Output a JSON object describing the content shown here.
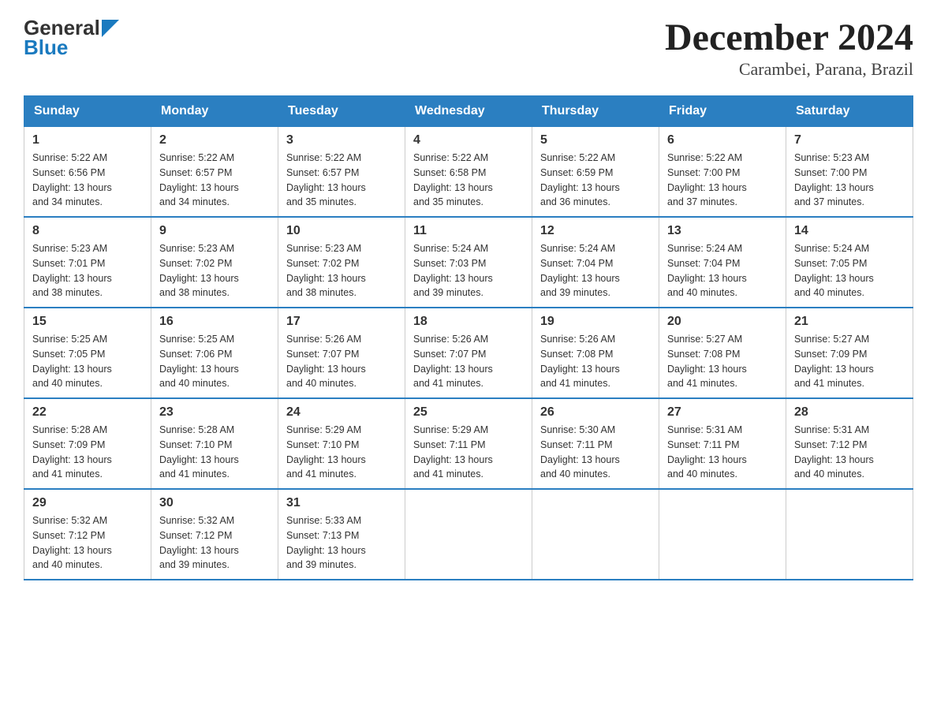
{
  "logo": {
    "general": "General",
    "blue": "Blue"
  },
  "title": "December 2024",
  "subtitle": "Carambei, Parana, Brazil",
  "weekdays": [
    "Sunday",
    "Monday",
    "Tuesday",
    "Wednesday",
    "Thursday",
    "Friday",
    "Saturday"
  ],
  "weeks": [
    [
      {
        "day": "1",
        "sunrise": "5:22 AM",
        "sunset": "6:56 PM",
        "daylight": "13 hours and 34 minutes."
      },
      {
        "day": "2",
        "sunrise": "5:22 AM",
        "sunset": "6:57 PM",
        "daylight": "13 hours and 34 minutes."
      },
      {
        "day": "3",
        "sunrise": "5:22 AM",
        "sunset": "6:57 PM",
        "daylight": "13 hours and 35 minutes."
      },
      {
        "day": "4",
        "sunrise": "5:22 AM",
        "sunset": "6:58 PM",
        "daylight": "13 hours and 35 minutes."
      },
      {
        "day": "5",
        "sunrise": "5:22 AM",
        "sunset": "6:59 PM",
        "daylight": "13 hours and 36 minutes."
      },
      {
        "day": "6",
        "sunrise": "5:22 AM",
        "sunset": "7:00 PM",
        "daylight": "13 hours and 37 minutes."
      },
      {
        "day": "7",
        "sunrise": "5:23 AM",
        "sunset": "7:00 PM",
        "daylight": "13 hours and 37 minutes."
      }
    ],
    [
      {
        "day": "8",
        "sunrise": "5:23 AM",
        "sunset": "7:01 PM",
        "daylight": "13 hours and 38 minutes."
      },
      {
        "day": "9",
        "sunrise": "5:23 AM",
        "sunset": "7:02 PM",
        "daylight": "13 hours and 38 minutes."
      },
      {
        "day": "10",
        "sunrise": "5:23 AM",
        "sunset": "7:02 PM",
        "daylight": "13 hours and 38 minutes."
      },
      {
        "day": "11",
        "sunrise": "5:24 AM",
        "sunset": "7:03 PM",
        "daylight": "13 hours and 39 minutes."
      },
      {
        "day": "12",
        "sunrise": "5:24 AM",
        "sunset": "7:04 PM",
        "daylight": "13 hours and 39 minutes."
      },
      {
        "day": "13",
        "sunrise": "5:24 AM",
        "sunset": "7:04 PM",
        "daylight": "13 hours and 40 minutes."
      },
      {
        "day": "14",
        "sunrise": "5:24 AM",
        "sunset": "7:05 PM",
        "daylight": "13 hours and 40 minutes."
      }
    ],
    [
      {
        "day": "15",
        "sunrise": "5:25 AM",
        "sunset": "7:05 PM",
        "daylight": "13 hours and 40 minutes."
      },
      {
        "day": "16",
        "sunrise": "5:25 AM",
        "sunset": "7:06 PM",
        "daylight": "13 hours and 40 minutes."
      },
      {
        "day": "17",
        "sunrise": "5:26 AM",
        "sunset": "7:07 PM",
        "daylight": "13 hours and 40 minutes."
      },
      {
        "day": "18",
        "sunrise": "5:26 AM",
        "sunset": "7:07 PM",
        "daylight": "13 hours and 41 minutes."
      },
      {
        "day": "19",
        "sunrise": "5:26 AM",
        "sunset": "7:08 PM",
        "daylight": "13 hours and 41 minutes."
      },
      {
        "day": "20",
        "sunrise": "5:27 AM",
        "sunset": "7:08 PM",
        "daylight": "13 hours and 41 minutes."
      },
      {
        "day": "21",
        "sunrise": "5:27 AM",
        "sunset": "7:09 PM",
        "daylight": "13 hours and 41 minutes."
      }
    ],
    [
      {
        "day": "22",
        "sunrise": "5:28 AM",
        "sunset": "7:09 PM",
        "daylight": "13 hours and 41 minutes."
      },
      {
        "day": "23",
        "sunrise": "5:28 AM",
        "sunset": "7:10 PM",
        "daylight": "13 hours and 41 minutes."
      },
      {
        "day": "24",
        "sunrise": "5:29 AM",
        "sunset": "7:10 PM",
        "daylight": "13 hours and 41 minutes."
      },
      {
        "day": "25",
        "sunrise": "5:29 AM",
        "sunset": "7:11 PM",
        "daylight": "13 hours and 41 minutes."
      },
      {
        "day": "26",
        "sunrise": "5:30 AM",
        "sunset": "7:11 PM",
        "daylight": "13 hours and 40 minutes."
      },
      {
        "day": "27",
        "sunrise": "5:31 AM",
        "sunset": "7:11 PM",
        "daylight": "13 hours and 40 minutes."
      },
      {
        "day": "28",
        "sunrise": "5:31 AM",
        "sunset": "7:12 PM",
        "daylight": "13 hours and 40 minutes."
      }
    ],
    [
      {
        "day": "29",
        "sunrise": "5:32 AM",
        "sunset": "7:12 PM",
        "daylight": "13 hours and 40 minutes."
      },
      {
        "day": "30",
        "sunrise": "5:32 AM",
        "sunset": "7:12 PM",
        "daylight": "13 hours and 39 minutes."
      },
      {
        "day": "31",
        "sunrise": "5:33 AM",
        "sunset": "7:13 PM",
        "daylight": "13 hours and 39 minutes."
      },
      null,
      null,
      null,
      null
    ]
  ],
  "labels": {
    "sunrise": "Sunrise:",
    "sunset": "Sunset:",
    "daylight": "Daylight:"
  }
}
